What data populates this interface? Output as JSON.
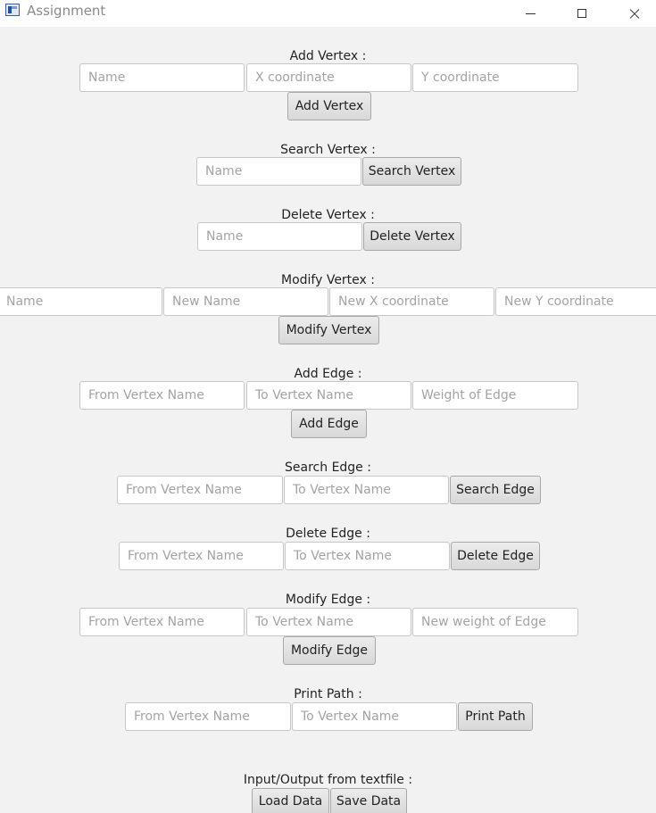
{
  "window": {
    "title": "Assignment",
    "icon": "java-app-icon"
  },
  "add_vertex": {
    "label": "Add Vertex :",
    "name_placeholder": "Name",
    "x_placeholder": "X coordinate",
    "y_placeholder": "Y coordinate",
    "button": "Add Vertex"
  },
  "search_vertex": {
    "label": "Search Vertex :",
    "name_placeholder": "Name",
    "button": "Search Vertex"
  },
  "delete_vertex": {
    "label": "Delete Vertex :",
    "name_placeholder": "Name",
    "button": "Delete Vertex"
  },
  "modify_vertex": {
    "label": "Modify Vertex :",
    "name_placeholder": "Name",
    "new_name_placeholder": "New Name",
    "new_x_placeholder": "New X coordinate",
    "new_y_placeholder": "New Y coordinate",
    "button": "Modify Vertex"
  },
  "add_edge": {
    "label": "Add Edge :",
    "from_placeholder": "From Vertex Name",
    "to_placeholder": "To Vertex Name",
    "weight_placeholder": "Weight of Edge",
    "button": "Add Edge"
  },
  "search_edge": {
    "label": "Search Edge :",
    "from_placeholder": "From Vertex Name",
    "to_placeholder": "To Vertex Name",
    "button": "Search Edge"
  },
  "delete_edge": {
    "label": "Delete Edge :",
    "from_placeholder": "From Vertex Name",
    "to_placeholder": "To Vertex Name",
    "button": "Delete Edge"
  },
  "modify_edge": {
    "label": "Modify Edge :",
    "from_placeholder": "From Vertex Name",
    "to_placeholder": "To Vertex Name",
    "weight_placeholder": "New weight of Edge",
    "button": "Modify Edge"
  },
  "print_path": {
    "label": "Print Path :",
    "from_placeholder": "From Vertex Name",
    "to_placeholder": "To Vertex Name",
    "button": "Print Path"
  },
  "io": {
    "label": "Input/Output from textfile :",
    "load_button": "Load Data",
    "save_button": "Save Data"
  }
}
